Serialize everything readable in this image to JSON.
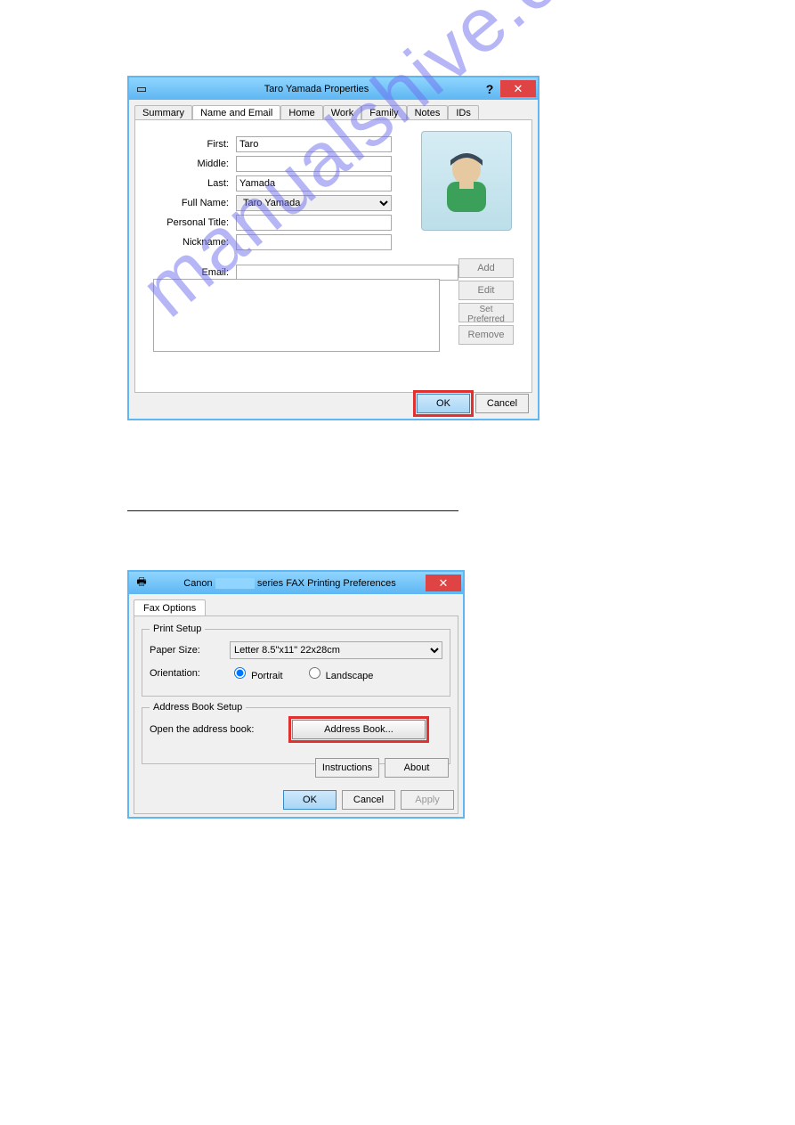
{
  "dialog1": {
    "title": "Taro Yamada Properties",
    "help": "?",
    "close": "✕",
    "tabs": {
      "summary": "Summary",
      "name_email": "Name and Email",
      "home": "Home",
      "work": "Work",
      "family": "Family",
      "notes": "Notes",
      "ids": "IDs"
    },
    "labels": {
      "first": "First:",
      "middle": "Middle:",
      "last": "Last:",
      "fullname": "Full Name:",
      "personal_title": "Personal Title:",
      "nickname": "Nickname:",
      "email": "Email:"
    },
    "values": {
      "first": "Taro",
      "middle": "",
      "last": "Yamada",
      "fullname": "Taro Yamada",
      "personal_title": "",
      "nickname": "",
      "email": ""
    },
    "email_buttons": {
      "add": "Add",
      "edit": "Edit",
      "set_preferred": "Set Preferred",
      "remove": "Remove"
    },
    "buttons": {
      "ok": "OK",
      "cancel": "Cancel"
    }
  },
  "dialog2": {
    "title_prefix": "Canon ",
    "title_suffix": " series FAX Printing Preferences",
    "close": "✕",
    "tab": "Fax Options",
    "print_setup": {
      "legend": "Print Setup",
      "paper_size_label": "Paper Size:",
      "paper_size_value": "Letter 8.5\"x11\" 22x28cm",
      "orientation_label": "Orientation:",
      "portrait": "Portrait",
      "landscape": "Landscape"
    },
    "address_book": {
      "legend": "Address Book Setup",
      "label": "Open the address book:",
      "button": "Address Book..."
    },
    "buttons": {
      "instructions": "Instructions",
      "about": "About",
      "ok": "OK",
      "cancel": "Cancel",
      "apply": "Apply"
    }
  },
  "watermark": "manualshive.com"
}
